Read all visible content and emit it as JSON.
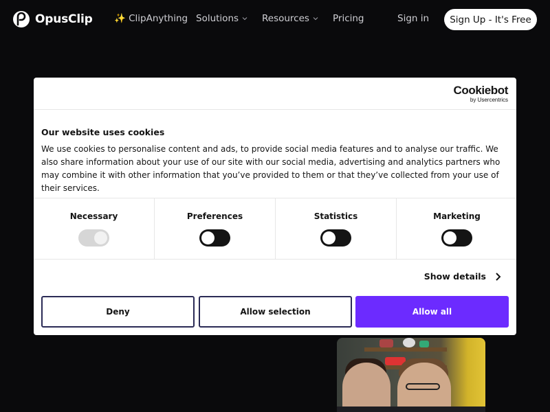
{
  "nav": {
    "brand": "OpusClip",
    "links": [
      {
        "label": "✨ ClipAnything",
        "has_caret": false
      },
      {
        "label": "Solutions",
        "has_caret": true
      },
      {
        "label": "Resources",
        "has_caret": true
      },
      {
        "label": "Pricing",
        "has_caret": false
      }
    ],
    "sign_in": "Sign in",
    "sign_up": "Sign Up - It's Free"
  },
  "cookie_dialog": {
    "provider_name": "Cookiebot",
    "provider_sub": "by Usercentrics",
    "title": "Our website uses cookies",
    "body": "We use cookies to personalise content and ads, to provide social media features and to analyse our traffic. We also share information about your use of our site with our social media, advertising and analytics partners who may combine it with other information that you’ve provided to them or that they’ve collected from your use of their services.",
    "categories": [
      {
        "label": "Necessary",
        "enabled": true,
        "locked": true
      },
      {
        "label": "Preferences",
        "enabled": false,
        "locked": false
      },
      {
        "label": "Statistics",
        "enabled": false,
        "locked": false
      },
      {
        "label": "Marketing",
        "enabled": false,
        "locked": false
      }
    ],
    "show_details": "Show details",
    "buttons": {
      "deny": "Deny",
      "allow_selection": "Allow selection",
      "allow_all": "Allow all"
    }
  },
  "colors": {
    "page_bg": "#0a0a0c",
    "accent": "#6c2bff",
    "button_border": "#2a2a55"
  }
}
